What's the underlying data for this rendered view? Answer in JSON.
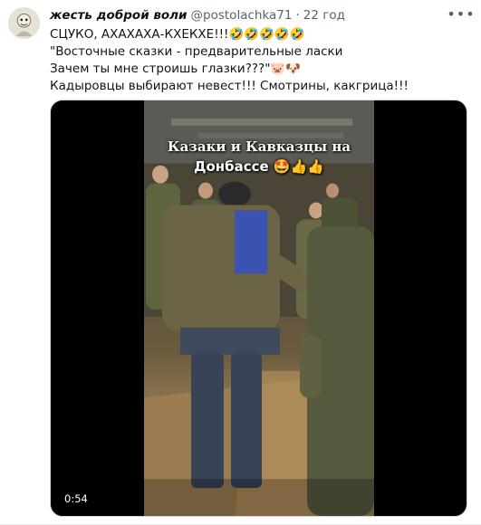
{
  "tweet": {
    "display_name": "жесть доброй воли",
    "handle": "@postolachka71",
    "separator": "·",
    "time": "22 год",
    "more_icon": "more-icon",
    "lines": [
      "СЦУКО, АХАХАХА-КХЕКХЕ!!!🤣🤣🤣🤣🤣",
      "\"Восточные сказки - предварительные ласки",
      "Зачем ты мне строишь глазки???\"🐷🐶",
      "Кадыровцы выбирают невест!!! Смотрины, какгрица!!!"
    ]
  },
  "media": {
    "overlay_line1": "Казаки и Кавказцы на",
    "overlay_line2": "Донбассе 🤩👍👍",
    "duration": "0:54"
  }
}
